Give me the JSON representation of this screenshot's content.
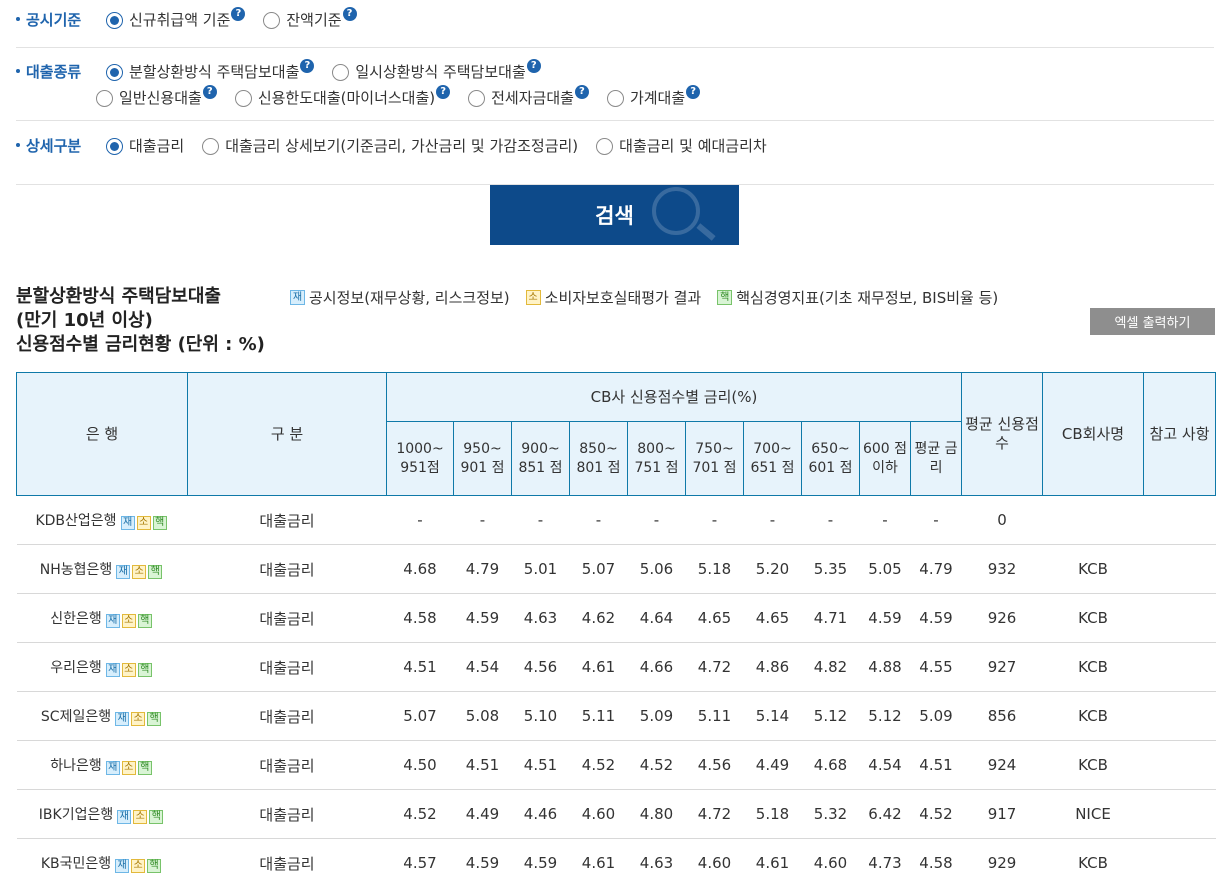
{
  "filters": {
    "disclosure": {
      "label": "공시기준",
      "options": [
        {
          "label": "신규취급액 기준",
          "selected": true,
          "help": true
        },
        {
          "label": "잔액기준",
          "selected": false,
          "help": true
        }
      ]
    },
    "loan_type": {
      "label": "대출종류",
      "rows": [
        [
          {
            "label": "분할상환방식 주택담보대출",
            "selected": true,
            "help": true
          },
          {
            "label": "일시상환방식 주택담보대출",
            "selected": false,
            "help": true
          }
        ],
        [
          {
            "label": "일반신용대출",
            "selected": false,
            "help": true
          },
          {
            "label": "신용한도대출(마이너스대출)",
            "selected": false,
            "help": true
          },
          {
            "label": "전세자금대출",
            "selected": false,
            "help": true
          },
          {
            "label": "가계대출",
            "selected": false,
            "help": true
          }
        ]
      ]
    },
    "detail": {
      "label": "상세구분",
      "options": [
        {
          "label": "대출금리",
          "selected": true,
          "help": false
        },
        {
          "label": "대출금리 상세보기(기준금리, 가산금리 및 가감조정금리)",
          "selected": false,
          "help": false
        },
        {
          "label": "대출금리 및 예대금리차",
          "selected": false,
          "help": false
        }
      ]
    },
    "help_glyph": "?"
  },
  "search_label": "검색",
  "result": {
    "title_lines": [
      "분할상환방식 주택담보대출",
      "(만기 10년 이상)",
      "신용점수별 금리현황 (단위 : %)"
    ],
    "legend": [
      {
        "tag": "재",
        "kind": "jae",
        "label": "공시정보(재무상황, 리스크정보)"
      },
      {
        "tag": "소",
        "kind": "so",
        "label": "소비자보호실태평가 결과"
      },
      {
        "tag": "핵",
        "kind": "haek",
        "label": "핵심경영지표(기초 재무정보, BIS비율 등)"
      }
    ],
    "excel_label": "엑셀 출력하기"
  },
  "table": {
    "headers": {
      "bank": "은 행",
      "category": "구 분",
      "group": "CB사 신용점수별 금리(%)",
      "avg_score": "평균 신용점수",
      "cb": "CB회사명",
      "note": "참고 사항",
      "ranges": [
        "1000~ 951점",
        "950~ 901 점",
        "900~ 851 점",
        "850~ 801 점",
        "800~ 751 점",
        "750~ 701 점",
        "700~ 651 점",
        "650~ 601 점",
        "600 점 이하",
        "평균 금리"
      ]
    },
    "tags": [
      "재",
      "소",
      "핵"
    ],
    "rows": [
      {
        "bank": "KDB산업은행",
        "category": "대출금리",
        "rates": [
          "-",
          "-",
          "-",
          "-",
          "-",
          "-",
          "-",
          "-",
          "-",
          "-"
        ],
        "avg_score": "0",
        "cb": "",
        "note": ""
      },
      {
        "bank": "NH농협은행",
        "category": "대출금리",
        "rates": [
          "4.68",
          "4.79",
          "5.01",
          "5.07",
          "5.06",
          "5.18",
          "5.20",
          "5.35",
          "5.05",
          "4.79"
        ],
        "avg_score": "932",
        "cb": "KCB",
        "note": ""
      },
      {
        "bank": "신한은행",
        "category": "대출금리",
        "rates": [
          "4.58",
          "4.59",
          "4.63",
          "4.62",
          "4.64",
          "4.65",
          "4.65",
          "4.71",
          "4.59",
          "4.59"
        ],
        "avg_score": "926",
        "cb": "KCB",
        "note": ""
      },
      {
        "bank": "우리은행",
        "category": "대출금리",
        "rates": [
          "4.51",
          "4.54",
          "4.56",
          "4.61",
          "4.66",
          "4.72",
          "4.86",
          "4.82",
          "4.88",
          "4.55"
        ],
        "avg_score": "927",
        "cb": "KCB",
        "note": ""
      },
      {
        "bank": "SC제일은행",
        "category": "대출금리",
        "rates": [
          "5.07",
          "5.08",
          "5.10",
          "5.11",
          "5.09",
          "5.11",
          "5.14",
          "5.12",
          "5.12",
          "5.09"
        ],
        "avg_score": "856",
        "cb": "KCB",
        "note": ""
      },
      {
        "bank": "하나은행",
        "category": "대출금리",
        "rates": [
          "4.50",
          "4.51",
          "4.51",
          "4.52",
          "4.52",
          "4.56",
          "4.49",
          "4.68",
          "4.54",
          "4.51"
        ],
        "avg_score": "924",
        "cb": "KCB",
        "note": ""
      },
      {
        "bank": "IBK기업은행",
        "category": "대출금리",
        "rates": [
          "4.52",
          "4.49",
          "4.46",
          "4.60",
          "4.80",
          "4.72",
          "5.18",
          "5.32",
          "6.42",
          "4.52"
        ],
        "avg_score": "917",
        "cb": "NICE",
        "note": ""
      },
      {
        "bank": "KB국민은행",
        "category": "대출금리",
        "rates": [
          "4.57",
          "4.59",
          "4.59",
          "4.61",
          "4.63",
          "4.60",
          "4.61",
          "4.60",
          "4.73",
          "4.58"
        ],
        "avg_score": "929",
        "cb": "KCB",
        "note": ""
      }
    ]
  },
  "colors": {
    "accent": "#1f64ad",
    "button": "#0d4a8a",
    "table_border": "#0f79a8",
    "header_bg": "#e7f3fb"
  }
}
